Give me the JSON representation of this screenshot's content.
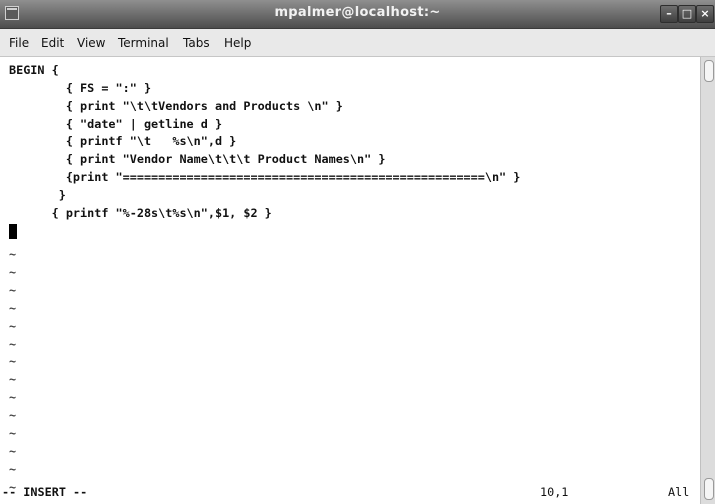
{
  "window": {
    "title": "mpalmer@localhost:~",
    "icon": "terminal-icon",
    "minimize_glyph": "–",
    "maximize_glyph": "□",
    "close_glyph": "×"
  },
  "menu": [
    "File",
    "Edit",
    "View",
    "Terminal",
    "Tabs",
    "Help"
  ],
  "editor": {
    "lines": [
      "BEGIN {",
      "        { FS = \":\" }",
      "        { print \"\\t\\tVendors and Products \\n\" }",
      "        { \"date\" | getline d }",
      "        { printf \"\\t   %s\\n\",d }",
      "        { print \"Vendor Name\\t\\t\\t Product Names\\n\" }",
      "        {print \"===================================================\\n\" }",
      "       }",
      "      { printf \"%-28s\\t%s\\n\",$1, $2 }"
    ],
    "tilde": "~",
    "tilde_count": 14,
    "status_mode": "-- INSERT --",
    "status_position": "10,1",
    "status_percent": "All"
  }
}
